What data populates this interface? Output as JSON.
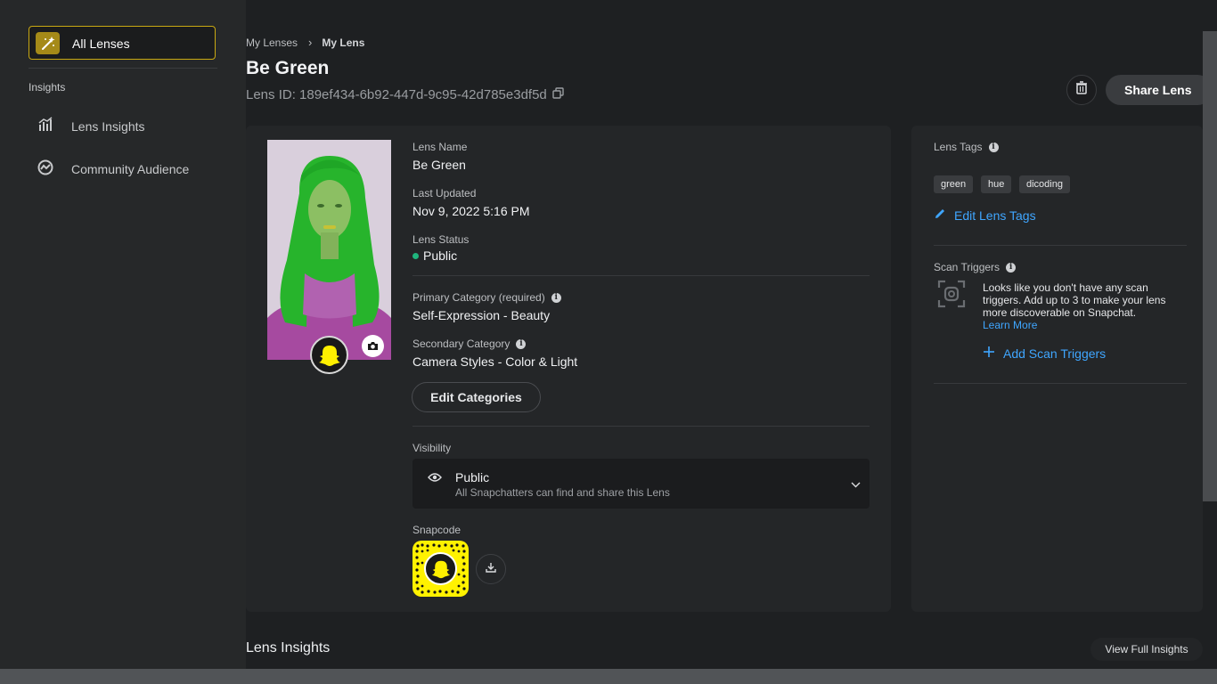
{
  "sidebar": {
    "all_lenses": "All Lenses",
    "section_label": "Insights",
    "items": [
      {
        "label": "Lens Insights",
        "icon": "bar-chart-icon"
      },
      {
        "label": "Community Audience",
        "icon": "trend-circle-icon"
      }
    ]
  },
  "breadcrumb": {
    "parent": "My Lenses",
    "current": "My Lens"
  },
  "header": {
    "title": "Be Green",
    "lens_id": "Lens ID: 189ef434-6b92-447d-9c95-42d785e3df5d",
    "share_label": "Share Lens"
  },
  "details": {
    "lens_name_label": "Lens Name",
    "lens_name": "Be Green",
    "last_updated_label": "Last Updated",
    "last_updated": "Nov 9, 2022 5:16 PM",
    "status_label": "Lens Status",
    "status": "Public",
    "primary_label": "Primary Category (required)",
    "primary": "Self-Expression - Beauty",
    "secondary_label": "Secondary Category",
    "secondary": "Camera Styles - Color & Light",
    "edit_categories": "Edit Categories",
    "visibility_label": "Visibility",
    "visibility_title": "Public",
    "visibility_sub": "All Snapchatters can find and share this Lens",
    "snapcode_label": "Snapcode"
  },
  "tags_panel": {
    "tags_label": "Lens Tags",
    "tags": [
      "green",
      "hue",
      "dicoding"
    ],
    "edit_tags": "Edit Lens Tags",
    "scan_label": "Scan Triggers",
    "scan_text": "Looks like you don't have any scan triggers. Add up to 3 to make your lens more discoverable on Snapchat.",
    "learn_more": "Learn More",
    "add_scan": "Add Scan Triggers"
  },
  "insights": {
    "title": "Lens Insights",
    "view_full": "View Full Insights"
  },
  "colors": {
    "accent_gold": "#c9a912",
    "link_blue": "#3fa6ff",
    "status_green": "#1fb57d",
    "snap_yellow": "#fff200"
  }
}
